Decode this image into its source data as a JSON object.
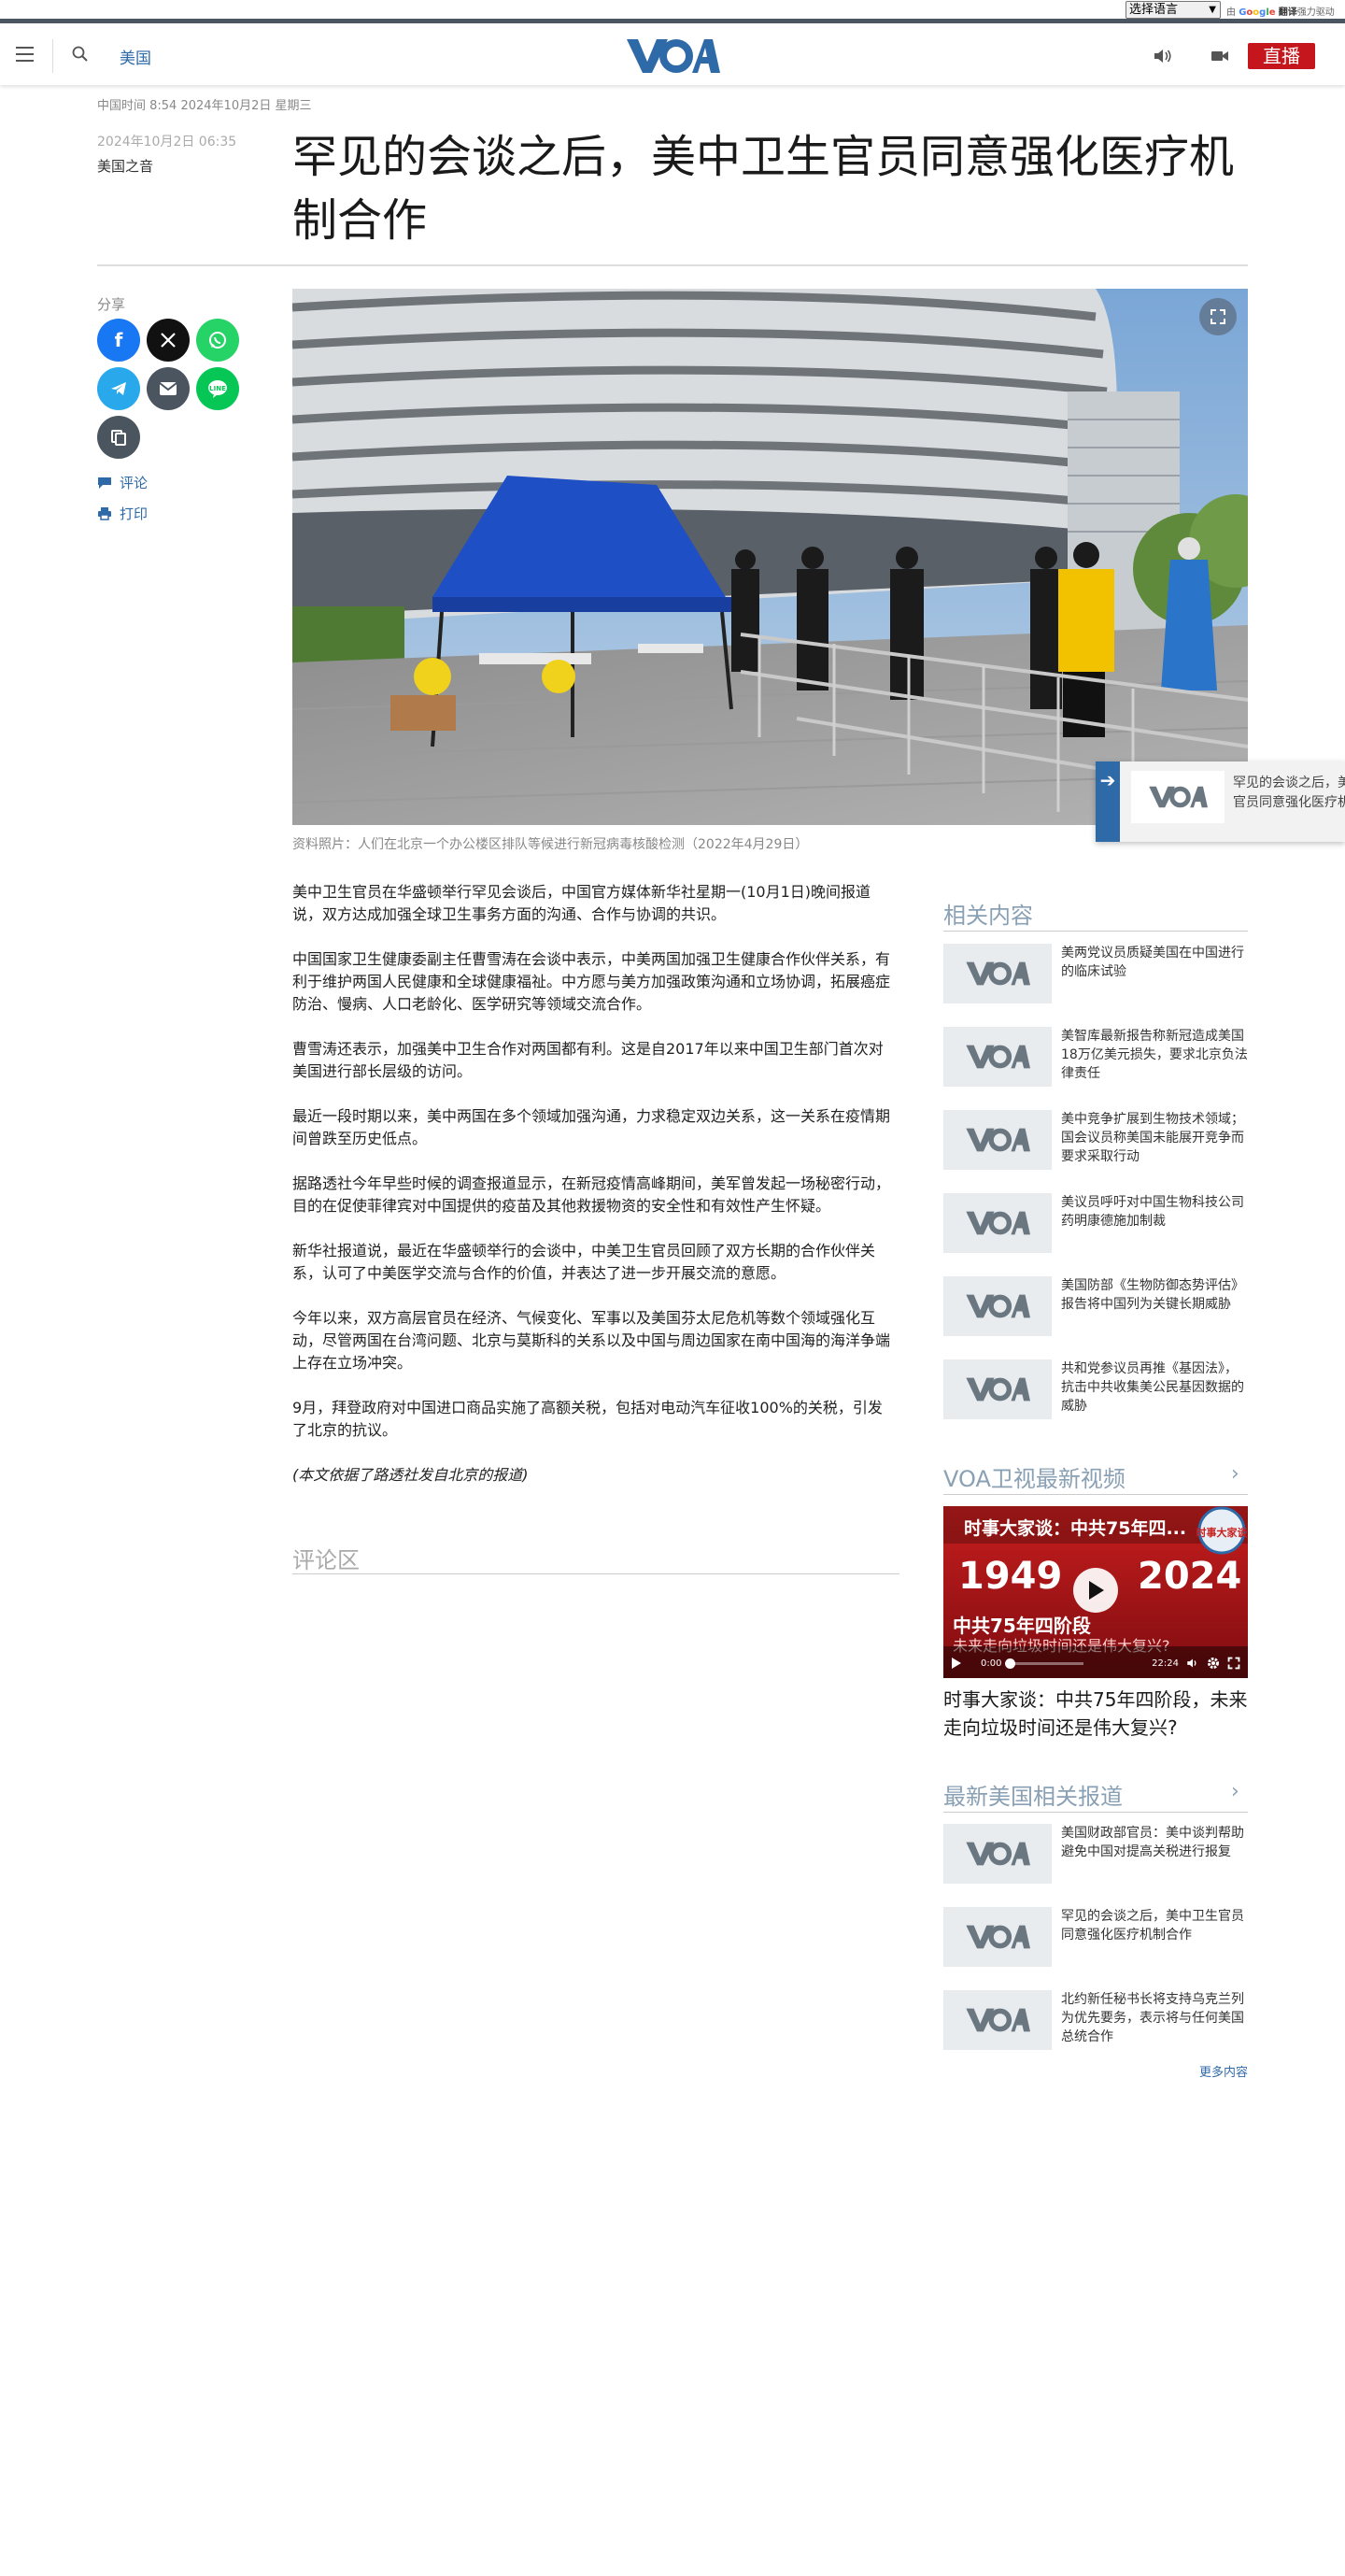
{
  "translate": {
    "select_label": "选择语言",
    "powered_by": "由",
    "google": "Google",
    "fanyi": "翻译",
    "powered_suffix": "强力驱动"
  },
  "header": {
    "section": "美国",
    "live": "直播"
  },
  "top_timestamp": "中国时间 8:54 2024年10月2日 星期三",
  "article": {
    "date": "2024年10月2日 06:35",
    "author": "美国之音",
    "title": "罕见的会谈之后，美中卫生官员同意强化医疗机制合作",
    "share_label": "分享",
    "comment_link": "评论",
    "print_link": "打印",
    "caption": "资料照片：人们在北京一个办公楼区排队等候进行新冠病毒核酸检测（2022年4月29日）",
    "paragraphs": [
      "美中卫生官员在华盛顿举行罕见会谈后，中国官方媒体新华社星期一(10月1日)晚间报道说，双方达成加强全球卫生事务方面的沟通、合作与协调的共识。",
      "中国国家卫生健康委副主任曹雪涛在会谈中表示，中美两国加强卫生健康合作伙伴关系，有利于维护两国人民健康和全球健康福祉。中方愿与美方加强政策沟通和立场协调，拓展癌症防治、慢病、人口老龄化、医学研究等领域交流合作。",
      "曹雪涛还表示，加强美中卫生合作对两国都有利。这是自2017年以来中国卫生部门首次对美国进行部长层级的访问。",
      "最近一段时期以来，美中两国在多个领域加强沟通，力求稳定双边关系，这一关系在疫情期间曾跌至历史低点。",
      "据路透社今年早些时候的调查报道显示，在新冠疫情高峰期间，美军曾发起一场秘密行动，目的在促使菲律宾对中国提供的疫苗及其他救援物资的安全性和有效性产生怀疑。",
      "新华社报道说，最近在华盛顿举行的会谈中，中美卫生官员回顾了双方长期的合作伙伴关系，认可了中美医学交流与合作的价值，并表达了进一步开展交流的意愿。",
      "今年以来，双方高层官员在经济、气候变化、军事以及美国芬太尼危机等数个领域强化互动，尽管两国在台湾问题、北京与莫斯科的关系以及中国与周边国家在南中国海的海洋争端上存在立场冲突。",
      "9月，拜登政府对中国进口商品实施了高额关税，包括对电动汽车征收100%的关税，引发了北京的抗议。",
      "(本文依据了路透社发自北京的报道)"
    ],
    "comments_heading": "评论区"
  },
  "floating_card": {
    "text_line1": "罕见的会谈之后，美中卫生",
    "text_line2": "官员同意强化医疗机制合作"
  },
  "sidebar": {
    "related_heading": "相关内容",
    "related": [
      "美两党议员质疑美国在中国进行的临床试验",
      "美智库最新报告称新冠造成美国18万亿美元损失，要求北京负法律责任",
      "美中竞争扩展到生物技术领域；国会议员称美国未能展开竞争而要求采取行动",
      "美议员呼吁对中国生物科技公司药明康德施加制裁",
      "美国防部《生物防御态势评估》报告将中国列为关键长期威胁",
      "共和党参议员再推《基因法》，抗击中共收集美公民基因数据的威胁"
    ],
    "video_heading": "VOA卫视最新视频",
    "video": {
      "title_overlay": "时事大家谈：中共75年四...",
      "year_left": "1949",
      "year_right": "2024",
      "banner": "中共75年四阶段",
      "banner_sub": "未来走向垃圾时间还是伟大复兴?",
      "badge": "时事大家谈",
      "time_current": "0:00",
      "time_total": "22:24",
      "caption": "时事大家谈：中共75年四阶段，未来走向垃圾时间还是伟大复兴?"
    },
    "latest_heading": "最新美国相关报道",
    "latest": [
      "美国财政部官员：美中谈判帮助避免中国对提高关税进行报复",
      "罕见的会谈之后，美中卫生官员同意强化医疗机制合作",
      "北约新任秘书长将支持乌克兰列为优先要务，表示将与任何美国总统合作"
    ],
    "more": "更多内容"
  }
}
